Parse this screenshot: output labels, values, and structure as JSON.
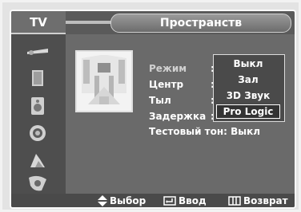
{
  "header": {
    "tab": "TV",
    "title": "Пространств"
  },
  "sidebar": {
    "items": [
      {
        "icon": "antenna-icon"
      },
      {
        "icon": "picture-icon"
      },
      {
        "icon": "speaker-icon"
      },
      {
        "icon": "channel-icon"
      },
      {
        "icon": "setup-icon"
      },
      {
        "icon": "input-icon"
      }
    ]
  },
  "menu": {
    "mode_label": "Режим",
    "center_label": "Центр",
    "rear_label": "Тыл",
    "delay_label": "Задержка",
    "test_tone": "Тестовый тон: Выкл"
  },
  "dropdown": {
    "options": [
      "Выкл",
      "Зал",
      "3D Звук",
      "Pro Logic"
    ],
    "selected": "Pro Logic"
  },
  "footer": {
    "select_label": "Выбор",
    "enter_label": "Ввод",
    "return_label": "Возврат"
  }
}
